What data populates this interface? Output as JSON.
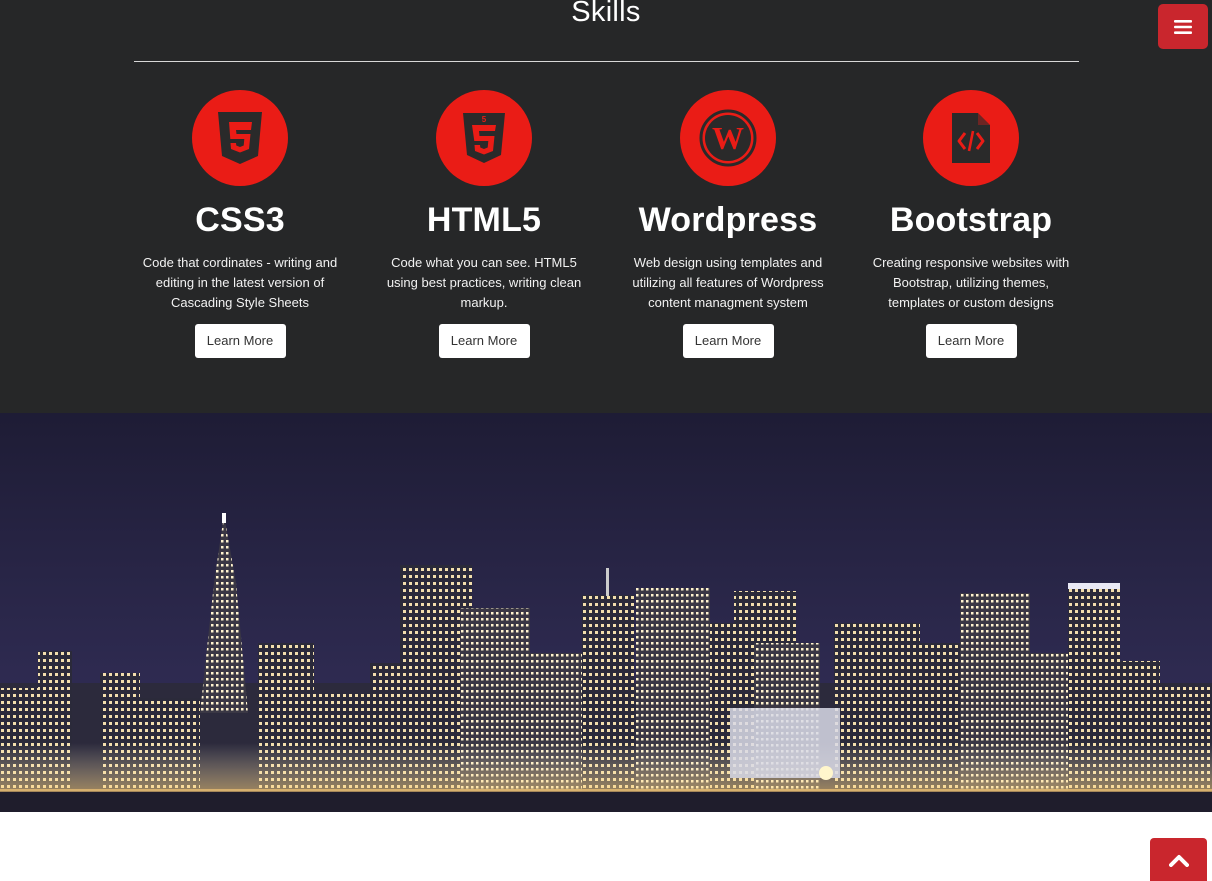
{
  "section": {
    "title": "Skills"
  },
  "skills": [
    {
      "icon": "css3-icon",
      "title": "CSS3",
      "description": "Code that cordinates - writing and editing in the latest version of Cascading Style Sheets",
      "button": "Learn More"
    },
    {
      "icon": "html5-icon",
      "title": "HTML5",
      "description": "Code what you can see. HTML5 using best practices, writing clean markup.",
      "button": "Learn More"
    },
    {
      "icon": "wordpress-icon",
      "title": "Wordpress",
      "description": "Web design using templates and utilizing all features of Wordpress content managment system",
      "button": "Learn More"
    },
    {
      "icon": "code-file-icon",
      "title": "Bootstrap",
      "description": "Creating responsive websites with Bootstrap, utilizing themes, templates or custom designs",
      "button": "Learn More"
    }
  ],
  "nav": {
    "menu_icon": "hamburger-icon",
    "top_icon": "chevron-up-icon"
  },
  "colors": {
    "accent": "#ea1c16",
    "button_red": "#c9262d",
    "section_bg": "#262728"
  }
}
